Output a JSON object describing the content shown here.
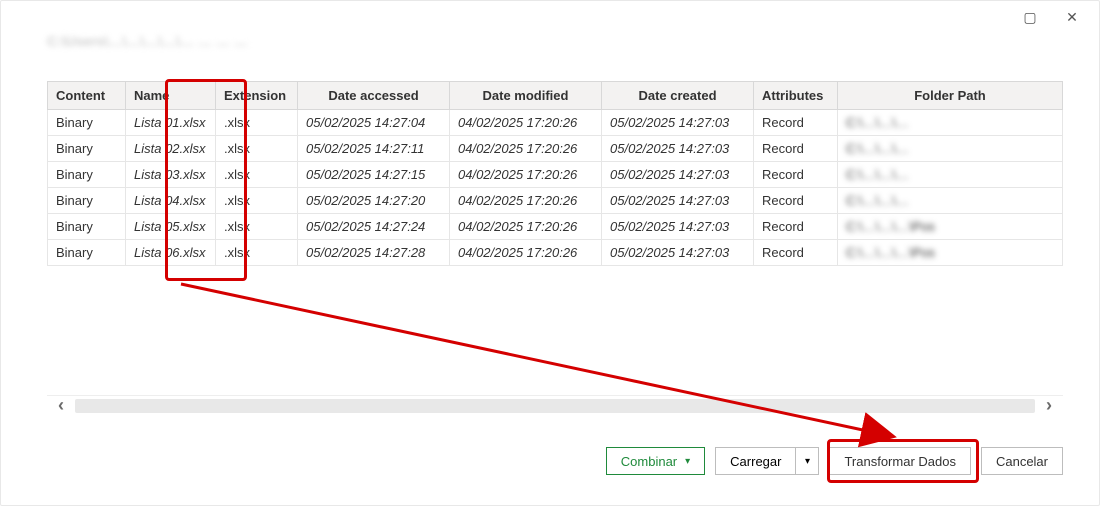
{
  "titlebar": {
    "maximize_glyph": "▢",
    "close_glyph": "✕"
  },
  "pathline": "C:\\Users\\…\\…\\…\\…\\… … … …",
  "columns": {
    "content": "Content",
    "name": "Name",
    "ext": "Extension",
    "accessed": "Date accessed",
    "modified": "Date modified",
    "created": "Date created",
    "attr": "Attributes",
    "folder": "Folder Path"
  },
  "rows": [
    {
      "content": "Binary",
      "name": "Lista 01.xlsx",
      "ext": ".xlsx",
      "accessed": "05/02/2025 14:27:04",
      "modified": "04/02/2025 17:20:26",
      "created": "05/02/2025 14:27:03",
      "attr": "Record",
      "folder": "C:\\…\\…\\…"
    },
    {
      "content": "Binary",
      "name": "Lista 02.xlsx",
      "ext": ".xlsx",
      "accessed": "05/02/2025 14:27:11",
      "modified": "04/02/2025 17:20:26",
      "created": "05/02/2025 14:27:03",
      "attr": "Record",
      "folder": "C:\\…\\…\\…"
    },
    {
      "content": "Binary",
      "name": "Lista 03.xlsx",
      "ext": ".xlsx",
      "accessed": "05/02/2025 14:27:15",
      "modified": "04/02/2025 17:20:26",
      "created": "05/02/2025 14:27:03",
      "attr": "Record",
      "folder": "C:\\…\\…\\…"
    },
    {
      "content": "Binary",
      "name": "Lista 04.xlsx",
      "ext": ".xlsx",
      "accessed": "05/02/2025 14:27:20",
      "modified": "04/02/2025 17:20:26",
      "created": "05/02/2025 14:27:03",
      "attr": "Record",
      "folder": "C:\\…\\…\\…"
    },
    {
      "content": "Binary",
      "name": "Lista 05.xlsx",
      "ext": ".xlsx",
      "accessed": "05/02/2025 14:27:24",
      "modified": "04/02/2025 17:20:26",
      "created": "05/02/2025 14:27:03",
      "attr": "Record",
      "folder": "C:\\…\\…\\…\\Pos"
    },
    {
      "content": "Binary",
      "name": "Lista 06.xlsx",
      "ext": ".xlsx",
      "accessed": "05/02/2025 14:27:28",
      "modified": "04/02/2025 17:20:26",
      "created": "05/02/2025 14:27:03",
      "attr": "Record",
      "folder": "C:\\…\\…\\…\\Pos"
    }
  ],
  "scroll": {
    "left_glyph": "‹",
    "right_glyph": "›"
  },
  "footer": {
    "combine": "Combinar",
    "load": "Carregar",
    "transform": "Transformar Dados",
    "cancel": "Cancelar",
    "caret": "▾"
  }
}
